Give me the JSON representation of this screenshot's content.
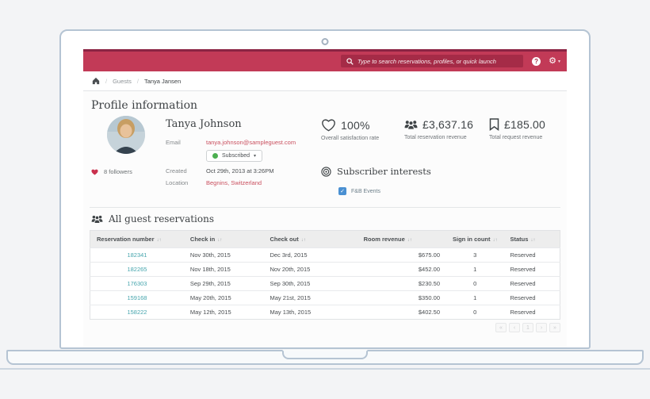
{
  "colors": {
    "brand_red": "#c23a57",
    "brand_red_dark": "#a52b47",
    "link_red": "#c94f5e",
    "link_teal": "#46a5ad",
    "subscribed_green": "#4caf50",
    "checkbox_blue": "#4a90d2"
  },
  "icons": {
    "help_glyph": "?",
    "gear_glyph": "⚙",
    "caret_glyph": "▾",
    "check_glyph": "✓",
    "sort_glyph": "↓↑"
  },
  "topbar": {
    "search_placeholder": "Type to search reservations, profiles, or quick launch"
  },
  "breadcrumb": {
    "separator": "/",
    "items": [
      "Guests",
      "Tanya Jansen"
    ]
  },
  "profile": {
    "section_title": "Profile information",
    "name": "Tanya Johnson",
    "email_label": "Email",
    "email": "tanya.johnson@sampleguest.com",
    "subscription_status": "Subscribed",
    "followers": "8 followers",
    "created_label": "Created",
    "created": "Oct 29th, 2013 at 3:26PM",
    "location_label": "Location",
    "location": "Begnins, Switzerland"
  },
  "stats": [
    {
      "icon": "heart-outline-icon",
      "value": "100%",
      "label": "Overall satisfaction rate"
    },
    {
      "icon": "people-icon",
      "value": "£3,637.16",
      "label": "Total reservation revenue"
    },
    {
      "icon": "bookmark-icon",
      "value": "£185.00",
      "label": "Total request revenue"
    }
  ],
  "interests": {
    "title": "Subscriber interests",
    "items": [
      "F&B Events"
    ]
  },
  "reservations": {
    "title": "All guest reservations",
    "columns": [
      "Reservation number",
      "Check in",
      "Check out",
      "Room revenue",
      "Sign in count",
      "Status"
    ],
    "rows": [
      {
        "number": "182341",
        "check_in": "Nov 30th, 2015",
        "check_out": "Dec 3rd, 2015",
        "revenue": "$675.00",
        "sign_in_count": "3",
        "status": "Reserved"
      },
      {
        "number": "182265",
        "check_in": "Nov 18th, 2015",
        "check_out": "Nov 20th, 2015",
        "revenue": "$452.00",
        "sign_in_count": "1",
        "status": "Reserved"
      },
      {
        "number": "176303",
        "check_in": "Sep 29th, 2015",
        "check_out": "Sep 30th, 2015",
        "revenue": "$230.50",
        "sign_in_count": "0",
        "status": "Reserved"
      },
      {
        "number": "159168",
        "check_in": "May 20th, 2015",
        "check_out": "May 21st, 2015",
        "revenue": "$350.00",
        "sign_in_count": "1",
        "status": "Reserved"
      },
      {
        "number": "158222",
        "check_in": "May 12th, 2015",
        "check_out": "May 13th, 2015",
        "revenue": "$402.50",
        "sign_in_count": "0",
        "status": "Reserved"
      }
    ],
    "pagination": [
      "«",
      "‹",
      "1",
      "›",
      "»"
    ]
  }
}
